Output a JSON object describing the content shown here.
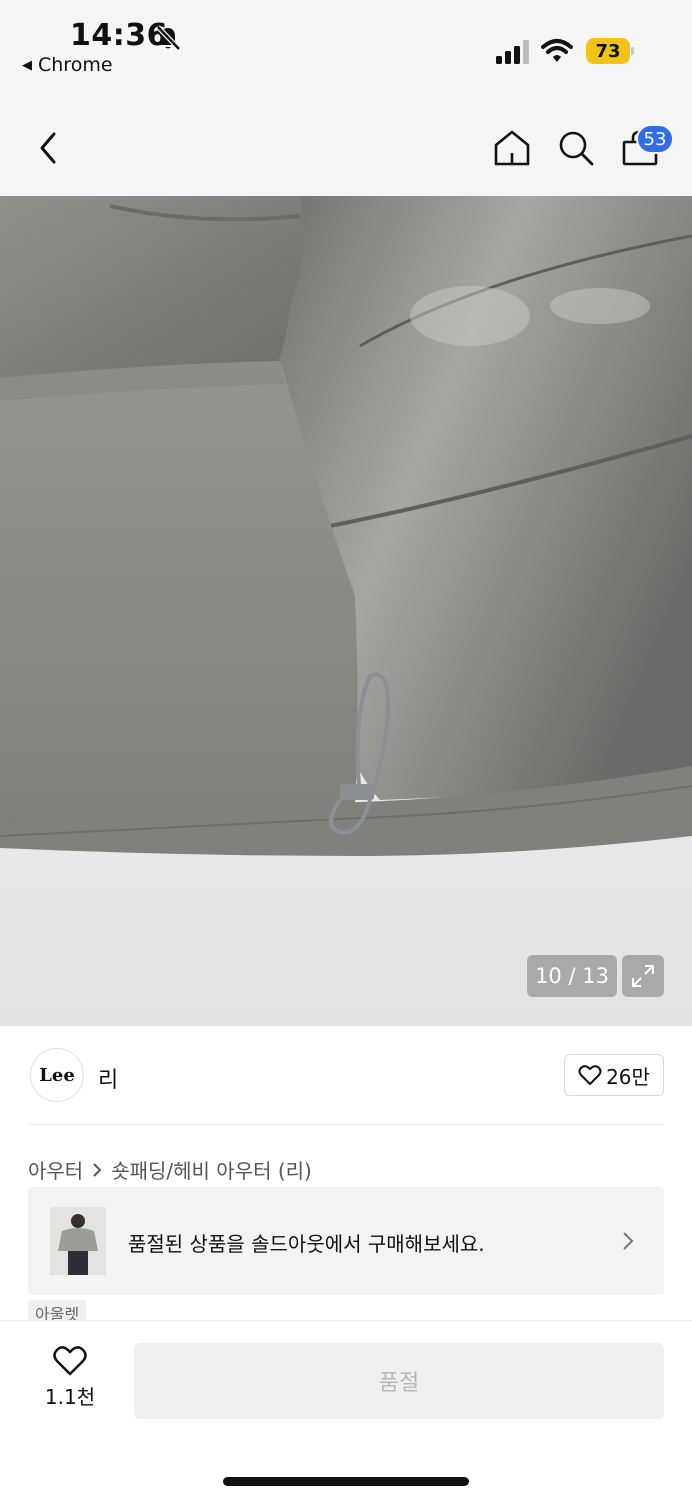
{
  "status_bar": {
    "time": "14:36",
    "back_app_label": "Chrome",
    "battery_level": "73",
    "battery_color": "#f2c316"
  },
  "header": {
    "cart_count": "53",
    "icons": [
      "chevron-left-icon",
      "home-icon",
      "search-icon",
      "shopping-bag-icon"
    ]
  },
  "gallery": {
    "counter": "10 / 13",
    "image_subject": "grey padded jacket detail"
  },
  "brand": {
    "logo_text": "Lee",
    "name": "리",
    "like_count": "26만"
  },
  "breadcrumb": {
    "category": "아우터",
    "subcategory": "숏패딩/헤비 아우터 (리)"
  },
  "soldout_banner": {
    "text": "품절된 상품을 솔드아웃에서 구매해보세요."
  },
  "tags": {
    "outlet": "아울렛"
  },
  "bottom_bar": {
    "wish_count": "1.1천",
    "buy_label": "품절"
  },
  "colors": {
    "accent_badge": "#2f6ee8",
    "disabled_button": "#efefef"
  }
}
